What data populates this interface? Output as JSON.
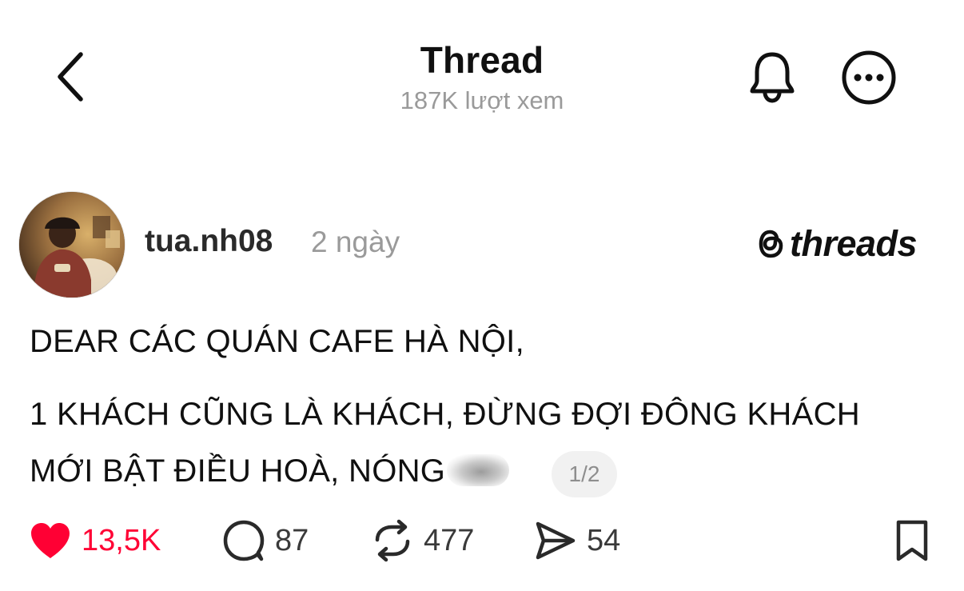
{
  "header": {
    "title": "Thread",
    "views": "187K lượt xem"
  },
  "post": {
    "username": "tua.nh08",
    "timestamp": "2 ngày",
    "brand": "threads",
    "lines": [
      "DEAR CÁC QUÁN CAFE HÀ NỘI,",
      "1 KHÁCH CŨNG LÀ KHÁCH, ĐỪNG ĐỢI ĐÔNG KHÁCH",
      "MỚI BẬT ĐIỀU HOÀ, NÓNG"
    ],
    "page_indicator": "1/2"
  },
  "actions": {
    "likes": "13,5K",
    "comments": "87",
    "reposts": "477",
    "shares": "54"
  },
  "icons": {
    "back": "chevron-left-icon",
    "bell": "bell-icon",
    "more": "more-circle-icon",
    "like": "heart-filled-icon",
    "comment": "comment-bubble-icon",
    "repost": "repost-icon",
    "share": "send-icon",
    "save": "bookmark-icon"
  },
  "colors": {
    "like_red": "#ff0034",
    "muted_gray": "#9a9a9a",
    "text": "#101010"
  }
}
